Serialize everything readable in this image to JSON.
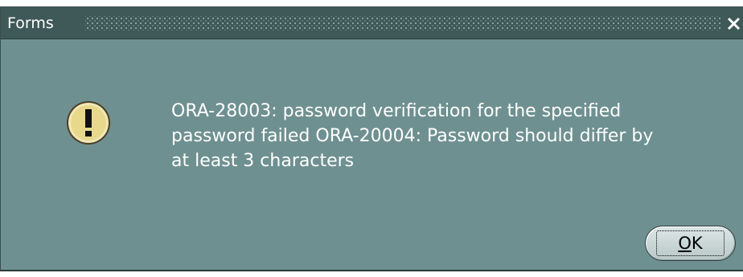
{
  "window": {
    "title": "Forms",
    "close_label": "Close",
    "background_color": "#6f9090",
    "titlebar_color": "#3f5858"
  },
  "message": {
    "icon": "warning-exclamation-icon",
    "text": "ORA-28003: password verification for the specified\npassword failed ORA-20004: Password should differ by\nat least 3 characters"
  },
  "buttons": {
    "ok_mnemonic": "O",
    "ok_rest": "K"
  }
}
